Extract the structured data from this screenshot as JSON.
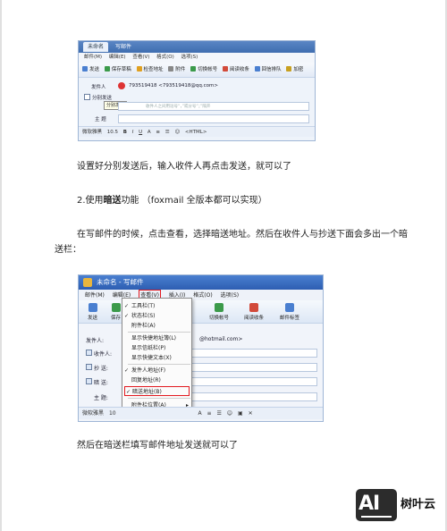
{
  "screenshot1": {
    "tabs": [
      "未命名",
      "写邮件"
    ],
    "menu": [
      "邮件(M)",
      "编辑(E)",
      "查看(V)",
      "格式(O)",
      "选项(S)"
    ],
    "toolbar": [
      "发送",
      "保存草稿",
      "检查地址",
      "附件",
      "切换帐号",
      "阅读收条",
      "回信排队",
      "加密"
    ],
    "from_label": "发件人",
    "from_value": "793519418 <793519418@qq.com>",
    "recipient_label": "分别发送",
    "tooltip": "分别发送",
    "recipient_hint": "收件人之间用逗号“，”或分号“；”隔开",
    "subject_label": "主 题",
    "format_font": "微软雅黑",
    "format_size": "10.5",
    "format_mode": "<HTML>"
  },
  "paragraphs": {
    "p1": "设置好分别发送后，输入收件人再点击发送，就可以了",
    "p2_prefix": "2.使用",
    "p2_bold": "暗送",
    "p2_suffix": "功能 （foxmail 全版本都可以实现）",
    "p3_line1": "在写邮件的时候，点击查看，选择暗送地址。然后在收件人与抄送下面会多出一个暗",
    "p3_line2": "送栏：",
    "p4": "然后在暗送栏填写邮件地址发送就可以了"
  },
  "screenshot2": {
    "title": "未命名 - 写邮件",
    "menu": [
      "邮件(M)",
      "编辑(E)",
      "查看(V)",
      "插入(I)",
      "格式(O)",
      "选项(S)"
    ],
    "toolbar": [
      "发送",
      "保存",
      "切换帐号",
      "阅读收条",
      "邮件标签"
    ],
    "fields": [
      "发件人:",
      "收件人:",
      "抄 送:",
      "暗 送:",
      "主 题:"
    ],
    "from_value": "@hotmail.com>",
    "view_menu": {
      "items": [
        {
          "label": "工具栏(T)",
          "checked": true
        },
        {
          "label": "状态栏(S)",
          "checked": true
        },
        {
          "label": "附件栏(A)",
          "checked": false
        },
        {
          "label": "显示快捷地址簿(L)",
          "checked": false
        },
        {
          "label": "显示信纸栏(P)",
          "checked": false
        },
        {
          "label": "显示快捷文本(X)",
          "checked": false
        },
        {
          "label": "发件人地址(F)",
          "checked": true
        },
        {
          "label": "回复地址(R)",
          "checked": false
        },
        {
          "label": "暗送地址(B)",
          "checked": true
        },
        {
          "label": "附件栏位置(A)",
          "checked": false
        }
      ]
    },
    "format_font": "微软雅黑",
    "format_size": "10"
  },
  "logo": {
    "mark": "AI",
    "text": "树叶云"
  },
  "colors": {
    "highlight": "#e2191f",
    "titlebar": "#3f6db0"
  }
}
